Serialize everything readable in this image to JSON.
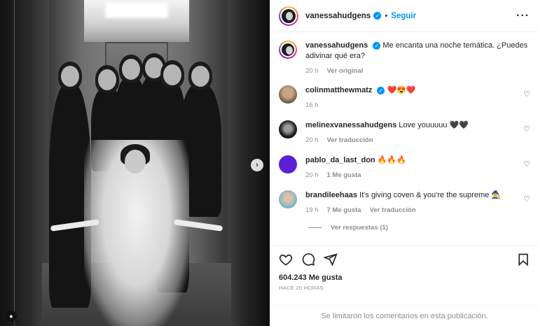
{
  "post": {
    "username": "vanessahudgens",
    "follow_label": "Seguir",
    "caption_username": "vanessahudgens",
    "caption": "Me encanta una noche temática. ¿Puedes adivinar qué era?",
    "caption_time": "20 h",
    "caption_translate": "Ver original"
  },
  "comments": [
    {
      "username": "colinmatthewmatz",
      "text": "❤️😍❤️",
      "time": "16 h",
      "likes": "",
      "reply": "",
      "translate": ""
    },
    {
      "username": "melinexvanessahudgens",
      "text": "Love youuuuu 🖤🖤",
      "time": "20 h",
      "likes": "",
      "reply": "",
      "translate": "Ver traducción"
    },
    {
      "username": "pablo_da_last_don",
      "text": "🔥🔥🔥",
      "time": "20 h",
      "likes": "1 Me gusta",
      "reply": "",
      "translate": ""
    },
    {
      "username": "brandileehaas",
      "text": "It's giving coven & you're the supreme 🧙‍♀️",
      "time": "19 h",
      "likes": "7 Me gusta",
      "reply": "",
      "translate": "Ver traducción"
    }
  ],
  "view_replies": "Ver respuestas (1)",
  "likes": "604.243 Me gusta",
  "posted_ago": "HACE 20 HORAS",
  "comments_limited": "Se limitaron los comentarios en esta publicación.",
  "icons": {
    "like": "heart-icon",
    "comment": "comment-icon",
    "share": "share-icon",
    "save": "bookmark-icon",
    "more": "more-options-icon",
    "next": "chevron-right-icon",
    "tag": "user-tag-icon"
  },
  "colors": {
    "accent": "#0095f6",
    "muted": "#8e8e8e",
    "text": "#262626"
  }
}
